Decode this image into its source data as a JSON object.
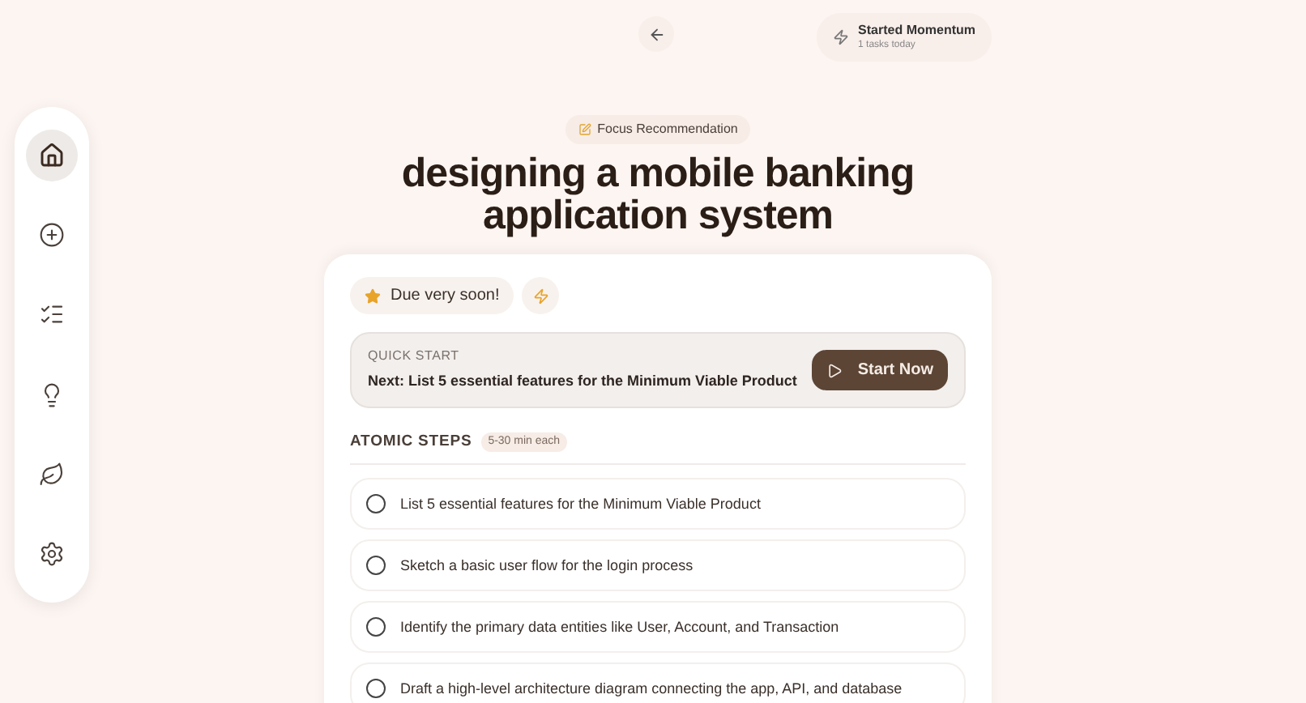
{
  "nav": [
    {
      "selected": true
    },
    {
      "selected": false
    },
    {
      "selected": false
    },
    {
      "selected": false
    },
    {
      "selected": false
    },
    {
      "selected": false
    }
  ],
  "momentum": {
    "title": "Started Momentum",
    "subtitle": "1 tasks today"
  },
  "badge": "Focus Recommendation",
  "title": "designing a mobile banking application system",
  "due": "Due very soon!",
  "quick_start": {
    "label": "QUICK START",
    "text": "Next: List 5 essential features for the Minimum Viable Product",
    "button": "Start Now"
  },
  "steps_heading": "ATOMIC STEPS",
  "steps_hint": "5-30 min each",
  "steps": [
    {
      "text": "List 5 essential features for the Minimum Viable Product",
      "checked": false
    },
    {
      "text": "Sketch a basic user flow for the login process",
      "checked": false
    },
    {
      "text": "Identify the primary data entities like User, Account, and Transaction",
      "checked": false
    },
    {
      "text": "Draft a high-level architecture diagram connecting the app, API, and database",
      "checked": false
    }
  ]
}
